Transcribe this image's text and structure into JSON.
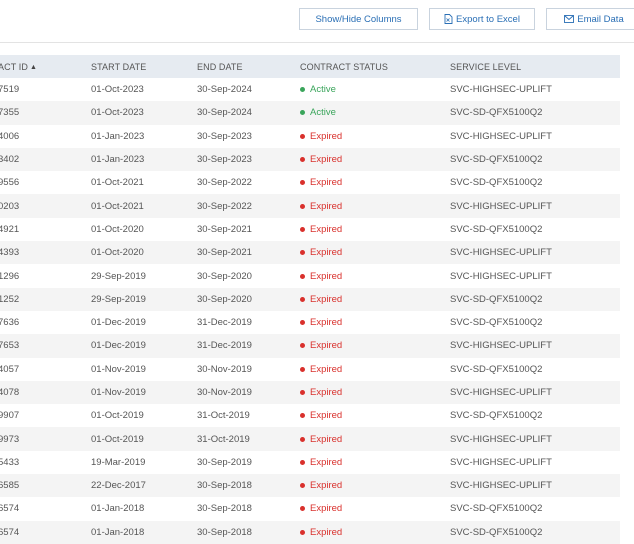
{
  "toolbar": {
    "show_hide_label": "Show/Hide Columns",
    "export_label": "Export to Excel",
    "email_label": "Email Data"
  },
  "table": {
    "headers": [
      "ACT ID",
      "START DATE",
      "END DATE",
      "CONTRACT STATUS",
      "SERVICE LEVEL"
    ],
    "rows": [
      {
        "id": "7519",
        "start": "01-Oct-2023",
        "end": "30-Sep-2024",
        "status": "Active",
        "level": "SVC-HIGHSEC-UPLIFT"
      },
      {
        "id": "7355",
        "start": "01-Oct-2023",
        "end": "30-Sep-2024",
        "status": "Active",
        "level": "SVC-SD-QFX5100Q2"
      },
      {
        "id": "4006",
        "start": "01-Jan-2023",
        "end": "30-Sep-2023",
        "status": "Expired",
        "level": "SVC-HIGHSEC-UPLIFT"
      },
      {
        "id": "3402",
        "start": "01-Jan-2023",
        "end": "30-Sep-2023",
        "status": "Expired",
        "level": "SVC-SD-QFX5100Q2"
      },
      {
        "id": "9556",
        "start": "01-Oct-2021",
        "end": "30-Sep-2022",
        "status": "Expired",
        "level": "SVC-SD-QFX5100Q2"
      },
      {
        "id": "0203",
        "start": "01-Oct-2021",
        "end": "30-Sep-2022",
        "status": "Expired",
        "level": "SVC-HIGHSEC-UPLIFT"
      },
      {
        "id": "4921",
        "start": "01-Oct-2020",
        "end": "30-Sep-2021",
        "status": "Expired",
        "level": "SVC-SD-QFX5100Q2"
      },
      {
        "id": "4393",
        "start": "01-Oct-2020",
        "end": "30-Sep-2021",
        "status": "Expired",
        "level": "SVC-HIGHSEC-UPLIFT"
      },
      {
        "id": "1296",
        "start": "29-Sep-2019",
        "end": "30-Sep-2020",
        "status": "Expired",
        "level": "SVC-HIGHSEC-UPLIFT"
      },
      {
        "id": "1252",
        "start": "29-Sep-2019",
        "end": "30-Sep-2020",
        "status": "Expired",
        "level": "SVC-SD-QFX5100Q2"
      },
      {
        "id": "7636",
        "start": "01-Dec-2019",
        "end": "31-Dec-2019",
        "status": "Expired",
        "level": "SVC-SD-QFX5100Q2"
      },
      {
        "id": "7653",
        "start": "01-Dec-2019",
        "end": "31-Dec-2019",
        "status": "Expired",
        "level": "SVC-HIGHSEC-UPLIFT"
      },
      {
        "id": "4057",
        "start": "01-Nov-2019",
        "end": "30-Nov-2019",
        "status": "Expired",
        "level": "SVC-SD-QFX5100Q2"
      },
      {
        "id": "4078",
        "start": "01-Nov-2019",
        "end": "30-Nov-2019",
        "status": "Expired",
        "level": "SVC-HIGHSEC-UPLIFT"
      },
      {
        "id": "9907",
        "start": "01-Oct-2019",
        "end": "31-Oct-2019",
        "status": "Expired",
        "level": "SVC-SD-QFX5100Q2"
      },
      {
        "id": "9973",
        "start": "01-Oct-2019",
        "end": "31-Oct-2019",
        "status": "Expired",
        "level": "SVC-HIGHSEC-UPLIFT"
      },
      {
        "id": "5433",
        "start": "19-Mar-2019",
        "end": "30-Sep-2019",
        "status": "Expired",
        "level": "SVC-HIGHSEC-UPLIFT"
      },
      {
        "id": "6585",
        "start": "22-Dec-2017",
        "end": "30-Sep-2018",
        "status": "Expired",
        "level": "SVC-HIGHSEC-UPLIFT"
      },
      {
        "id": "6574",
        "start": "01-Jan-2018",
        "end": "30-Sep-2018",
        "status": "Expired",
        "level": "SVC-SD-QFX5100Q2"
      },
      {
        "id": "6574",
        "start": "01-Jan-2018",
        "end": "30-Sep-2018",
        "status": "Expired",
        "level": "SVC-SD-QFX5100Q2"
      }
    ]
  },
  "icons": {
    "sort": "sort-both-icon",
    "export": "excel-file-icon",
    "email": "envelope-icon"
  },
  "colors": {
    "active": "#3aa55b",
    "expired": "#d9302c",
    "link": "#2a6fb5",
    "header_bg": "#e6ebf1"
  }
}
